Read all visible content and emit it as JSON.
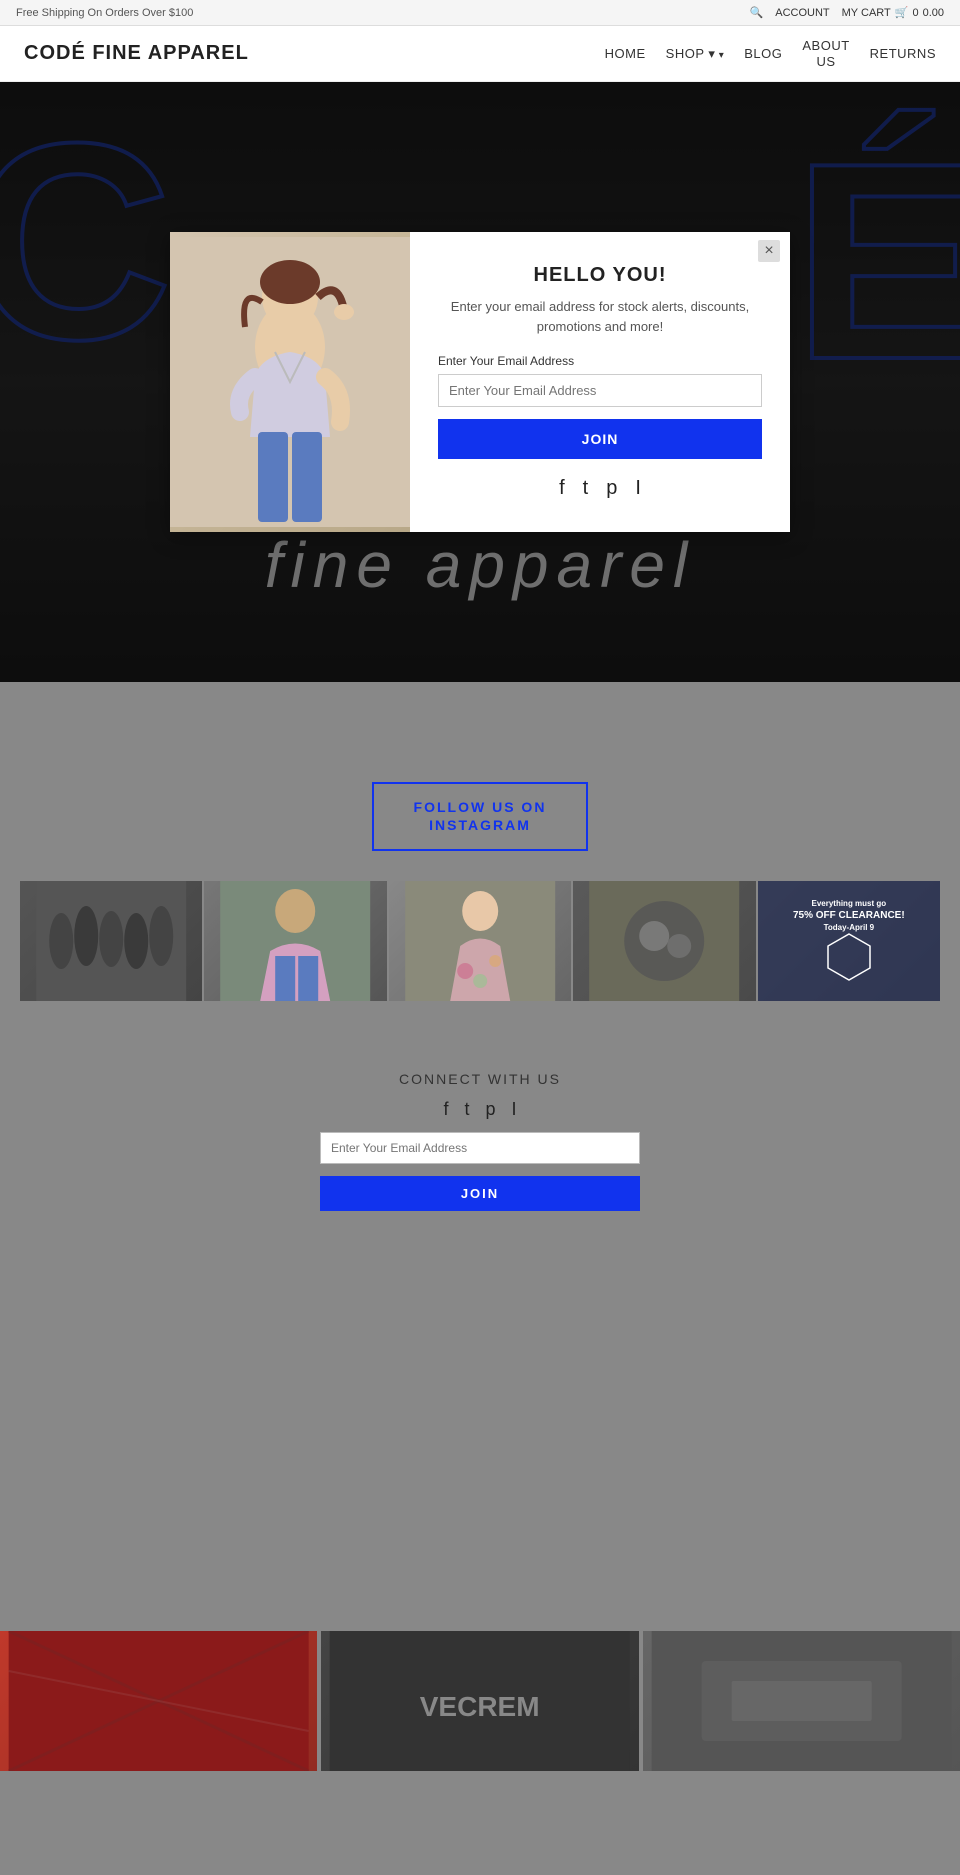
{
  "topbar": {
    "shipping_text": "Free Shipping On Orders Over $100",
    "my_cart": "MY CART",
    "cart_icon": "cart-icon",
    "cart_count": "0",
    "cart_price": "0.00",
    "account": "ACCOUNT",
    "search_icon": "search-icon"
  },
  "header": {
    "title": "CODÉ FINE APPAREL",
    "nav": [
      {
        "label": "HOME",
        "has_dropdown": false
      },
      {
        "label": "SHOP",
        "has_dropdown": true
      },
      {
        "label": "BLOG",
        "has_dropdown": false
      },
      {
        "label": "ABOUT US",
        "has_dropdown": false
      },
      {
        "label": "RETURNS",
        "has_dropdown": false
      }
    ]
  },
  "hero": {
    "letter_left": "C",
    "letter_right": "É",
    "fine_apparel": "fine apparel"
  },
  "modal": {
    "title": "HELLO YOU!",
    "subtitle": "Enter your email address for stock alerts, discounts, promotions and more!",
    "email_label": "Enter Your Email Address",
    "email_placeholder": "Enter Your Email Address",
    "join_button": "JOIN",
    "close_label": "×",
    "social_icons": [
      "facebook-icon",
      "twitter-icon",
      "pinterest-icon",
      "instagram-icon"
    ]
  },
  "instagram": {
    "follow_button": "FOLLOW US ON\nINSTAGRAM",
    "overlay_text": "Everything must go\n75% OFF CLEARANCE!\nToday-April 9"
  },
  "connect": {
    "title": "CONNECT WITH US",
    "email_placeholder": "Enter Your Email Address",
    "join_button": "JOIN",
    "social_icons": [
      "facebook-icon",
      "twitter-icon",
      "pinterest-icon",
      "instagram-icon"
    ]
  }
}
